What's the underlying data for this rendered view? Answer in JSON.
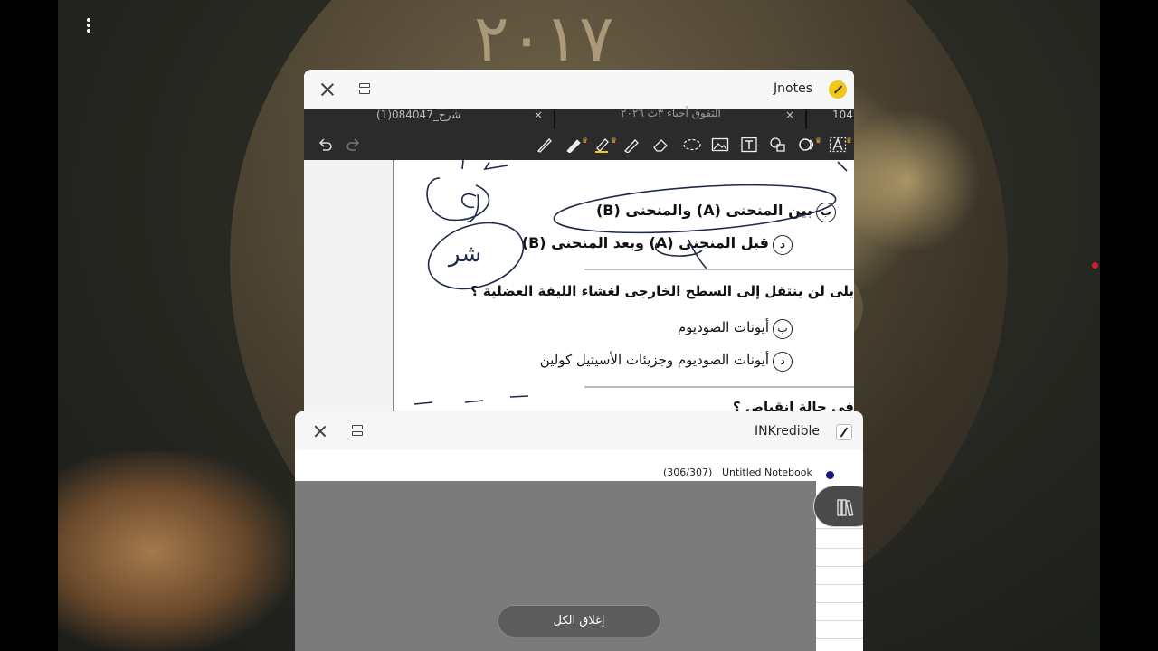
{
  "jnotes": {
    "app_title": "Jnotes",
    "tabs": [
      {
        "label": "شرح_084047(1)"
      },
      {
        "label": "التفوق أحياء ٣ث ٢٠٢٦"
      },
      {
        "label": "104"
      }
    ],
    "tab_close_glyph": "×",
    "document": {
      "lines": [
        {
          "label": "ب",
          "text": "بين المنحنى (A) والمنحنى (B)"
        },
        {
          "label": "د",
          "text": "قبل المنحنى (A) وبعد المنحنى (B)"
        },
        {
          "label": "",
          "text": "يلى لن ينتقل إلى السطح الخارجى لغشاء الليفة العضلية ؟"
        },
        {
          "label": "ب",
          "text": "أيونات الصوديوم"
        },
        {
          "label": "د",
          "text": "أيونات الصوديوم وجزيئات الأسيتيل كولين"
        },
        {
          "label": "",
          "text": "فى حالة انقباض ؟"
        }
      ],
      "handwriting": "شر"
    },
    "tools": [
      "undo-icon",
      "redo-icon",
      "pen-icon",
      "pencil-icon",
      "highlighter-icon",
      "marker-icon",
      "eraser-icon",
      "lasso-icon",
      "image-icon",
      "text-icon",
      "shapes-icon",
      "ocr-icon",
      "text-recognition-icon"
    ]
  },
  "inkredible": {
    "app_title": "INKredible",
    "page_count": "(306/307)",
    "notebook_name": "Untitled Notebook",
    "close_all_label": "إغلاق الكل"
  },
  "wallpaper": {
    "digits": "٢٠١٧"
  },
  "colors": {
    "toolbar": "#2b2b2b",
    "ink": "#1e2a4a",
    "jnotes_logo": "#f2c71a",
    "status_dot": "#c8232c"
  }
}
